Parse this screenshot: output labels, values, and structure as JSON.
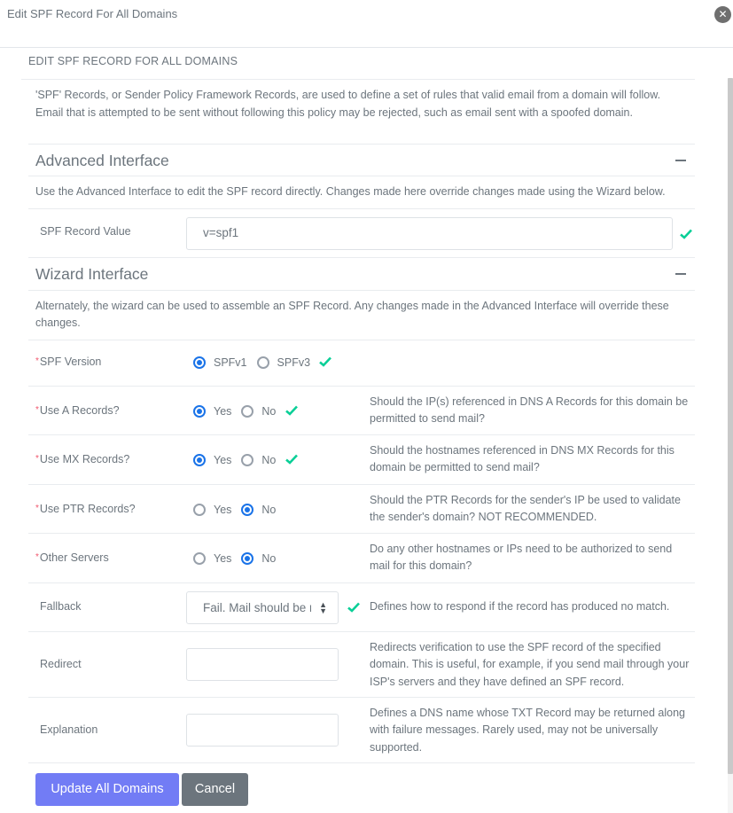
{
  "modal": {
    "title": "Edit SPF Record For All Domains",
    "close_icon": "close-circle-icon"
  },
  "panel": {
    "title": "EDIT SPF RECORD FOR ALL DOMAINS",
    "intro": "'SPF' Records, or Sender Policy Framework Records, are used to define a set of rules that valid email from a domain will follow. Email that is attempted to be sent without following this policy may be rejected, such as email sent with a spoofed domain."
  },
  "advanced": {
    "title": "Advanced Interface",
    "collapse_icon": "minus-icon",
    "description": "Use the Advanced Interface to edit the SPF record directly. Changes made here override changes made using the Wizard below.",
    "record_label": "SPF Record Value",
    "record_value": "v=spf1",
    "valid_icon": "check-icon"
  },
  "wizard": {
    "title": "Wizard Interface",
    "collapse_icon": "minus-icon",
    "description": "Alternately, the wizard can be used to assemble an SPF Record. Any changes made in the Advanced Interface will override these changes.",
    "required_marker": "*",
    "fields": [
      {
        "label": "SPF Version",
        "options": [
          "SPFv1",
          "SPFv3"
        ],
        "selected": "SPFv1",
        "valid": true,
        "help": ""
      },
      {
        "label": "Use A Records?",
        "options": [
          "Yes",
          "No"
        ],
        "selected": "Yes",
        "valid": true,
        "help": "Should the IP(s) referenced in DNS A Records for this domain be permitted to send mail?"
      },
      {
        "label": "Use MX Records?",
        "options": [
          "Yes",
          "No"
        ],
        "selected": "Yes",
        "valid": true,
        "help": "Should the hostnames referenced in DNS MX Records for this domain be permitted to send mail?"
      },
      {
        "label": "Use PTR Records?",
        "options": [
          "Yes",
          "No"
        ],
        "selected": "No",
        "valid": false,
        "help": "Should the PTR Records for the sender's IP be used to validate the sender's domain? NOT RECOMMENDED."
      },
      {
        "label": "Other Servers",
        "options": [
          "Yes",
          "No"
        ],
        "selected": "No",
        "valid": false,
        "help": "Do any other hostnames or IPs need to be authorized to send mail for this domain?"
      }
    ],
    "fallback": {
      "label": "Fallback",
      "value": "Fail. Mail should be rejected",
      "help": "Defines how to respond if the record has produced no match."
    },
    "redirect": {
      "label": "Redirect",
      "value": "",
      "help": "Redirects verification to use the SPF record of the specified domain. This is useful, for example, if you send mail through your ISP's servers and they have defined an SPF record."
    },
    "explanation": {
      "label": "Explanation",
      "value": "",
      "help": "Defines a DNS name whose TXT Record may be returned along with failure messages. Rarely used, may not be universally supported."
    }
  },
  "footer": {
    "update_label": "Update All Domains",
    "cancel_label": "Cancel"
  },
  "colors": {
    "primary": "#727cf5",
    "secondary": "#6c757d",
    "radio_checked": "#1a73e8",
    "success_check": "#0acf97",
    "required": "#f1556c"
  }
}
